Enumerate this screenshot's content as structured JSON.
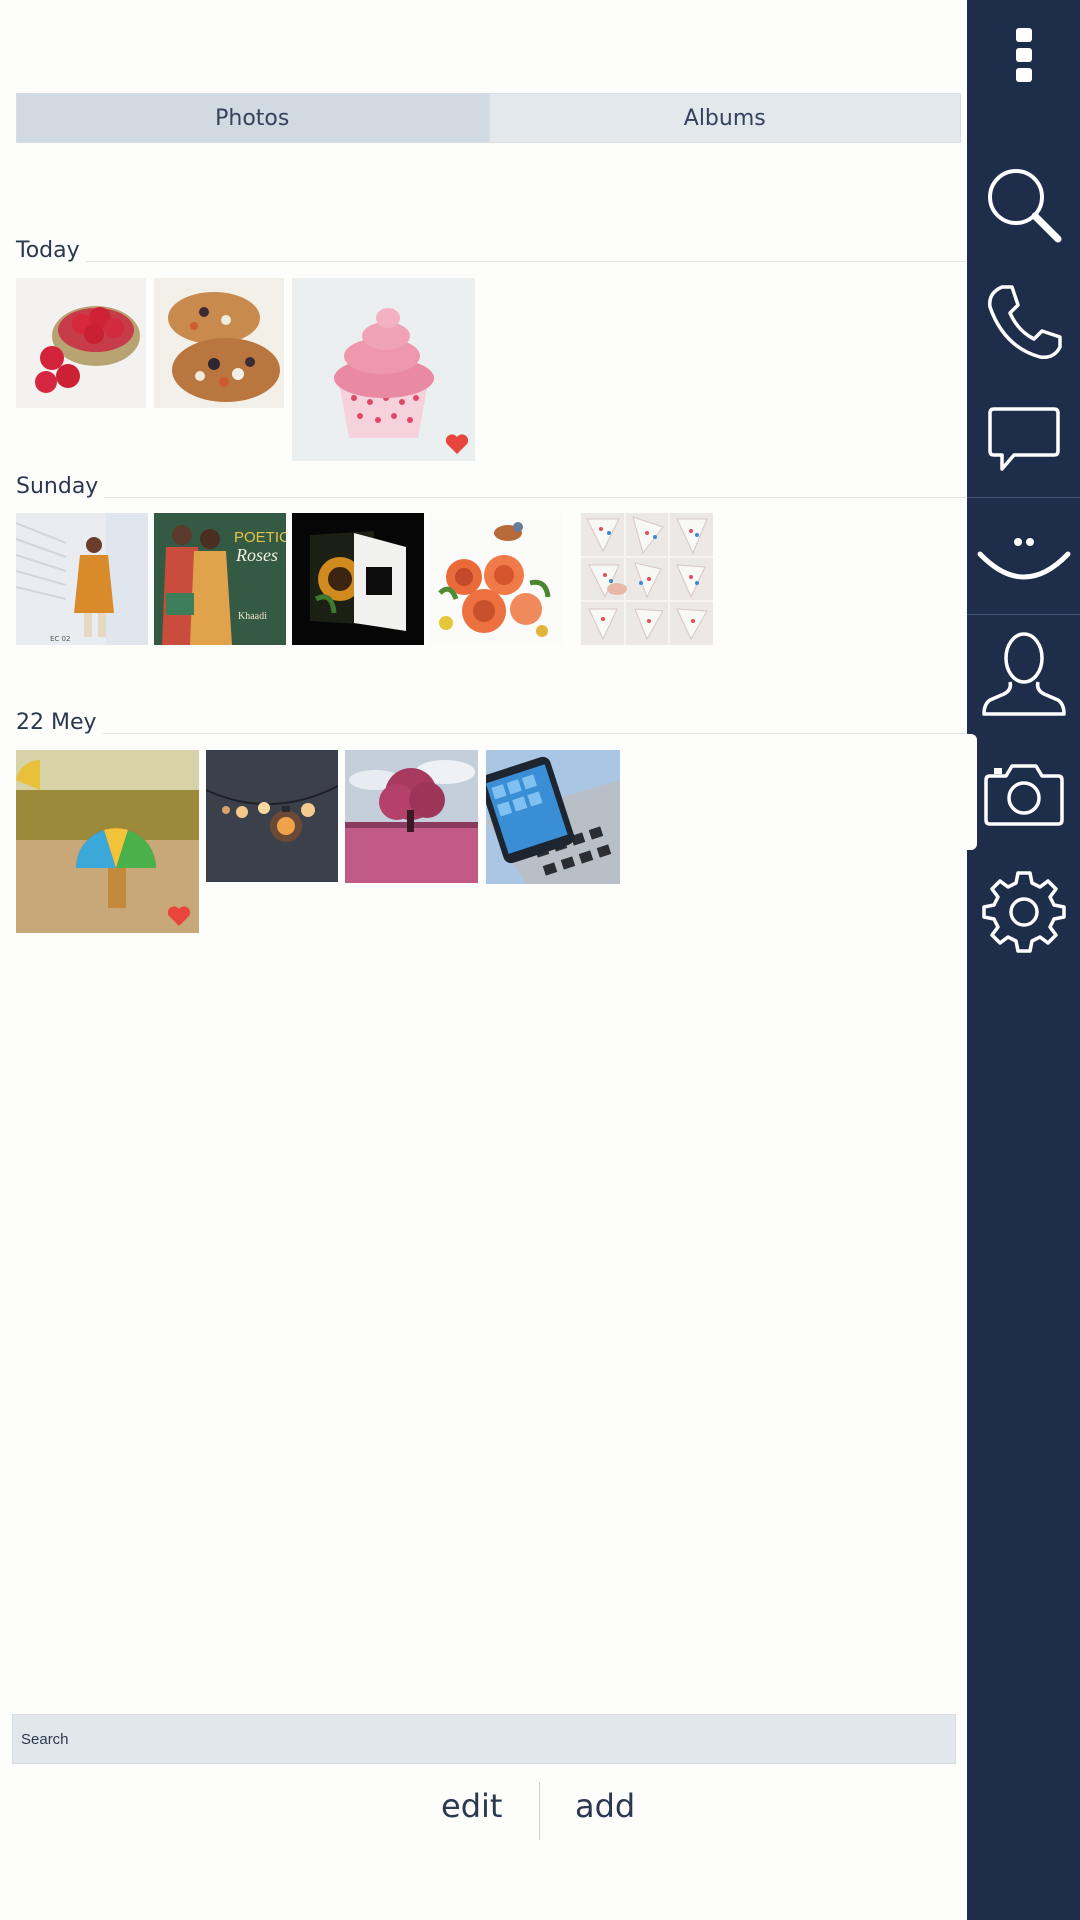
{
  "tabs": [
    {
      "label": "Photos",
      "active": true
    },
    {
      "label": "Albums",
      "active": false
    }
  ],
  "sections": [
    {
      "label": "Today",
      "photos": [
        {
          "subject": "raspberries",
          "favorite": false
        },
        {
          "subject": "mini-pizzas",
          "favorite": false
        },
        {
          "subject": "pink-cupcake",
          "favorite": true
        }
      ]
    },
    {
      "label": "Sunday",
      "photos": [
        {
          "subject": "fashion-model-orange",
          "favorite": false
        },
        {
          "subject": "poetic-roses-poster",
          "favorite": false
        },
        {
          "subject": "sunflower-card",
          "favorite": false
        },
        {
          "subject": "bird-flowers-illustration",
          "favorite": false
        },
        {
          "subject": "origami-steps",
          "favorite": false
        }
      ]
    },
    {
      "label": "22 Mey",
      "photos": [
        {
          "subject": "rainbow-umbrella",
          "favorite": true
        },
        {
          "subject": "light-bulbs-bokeh",
          "favorite": false
        },
        {
          "subject": "pink-tree-field",
          "favorite": false
        },
        {
          "subject": "smartphone-keyboard",
          "favorite": false
        }
      ]
    }
  ],
  "poster_text": {
    "title": "POETIC",
    "subtitle": "Roses",
    "brand": "Khaadi"
  },
  "sidebar": {
    "items": [
      {
        "icon": "more-vertical-icon"
      },
      {
        "icon": "search-icon"
      },
      {
        "icon": "phone-icon"
      },
      {
        "icon": "chat-bubble-icon"
      },
      {
        "icon": "smiley-icon"
      },
      {
        "icon": "user-icon"
      },
      {
        "icon": "camera-icon",
        "active": true
      },
      {
        "icon": "gear-icon"
      }
    ]
  },
  "search": {
    "placeholder": "Search"
  },
  "actions": {
    "edit": "edit",
    "add": "add"
  },
  "colors": {
    "sidebar_bg": "#1e2e4a",
    "tab_active": "#d2dae1",
    "tab_inactive": "#e3e8ec",
    "heart": "#e8463c",
    "text": "#2b3850"
  }
}
